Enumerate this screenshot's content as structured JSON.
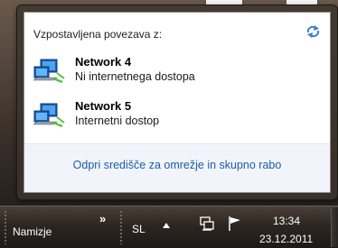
{
  "flyout": {
    "header": "Vzpostavljena povezava z:",
    "networks": [
      {
        "name": "Network 4",
        "status": "Ni internetnega dostopa"
      },
      {
        "name": "Network 5",
        "status": "Internetni dostop"
      }
    ],
    "footer_link": "Odpri središče za omrežje in skupno rabo"
  },
  "taskbar": {
    "desktop_label": "Namizje",
    "overflow_chevron": "»",
    "language": "SL",
    "clock_time": "13:34",
    "clock_date": "23.12.2011"
  },
  "colors": {
    "link": "#1e5aa8",
    "panel_bg": "#ffffff",
    "footer_bg": "#f1f5fb",
    "taskbar": "#2c2622"
  },
  "icons": [
    "refresh-icon",
    "network-icon",
    "network-icon",
    "show-hidden-icons-icon",
    "network-tray-icon",
    "action-center-flag-icon"
  ]
}
